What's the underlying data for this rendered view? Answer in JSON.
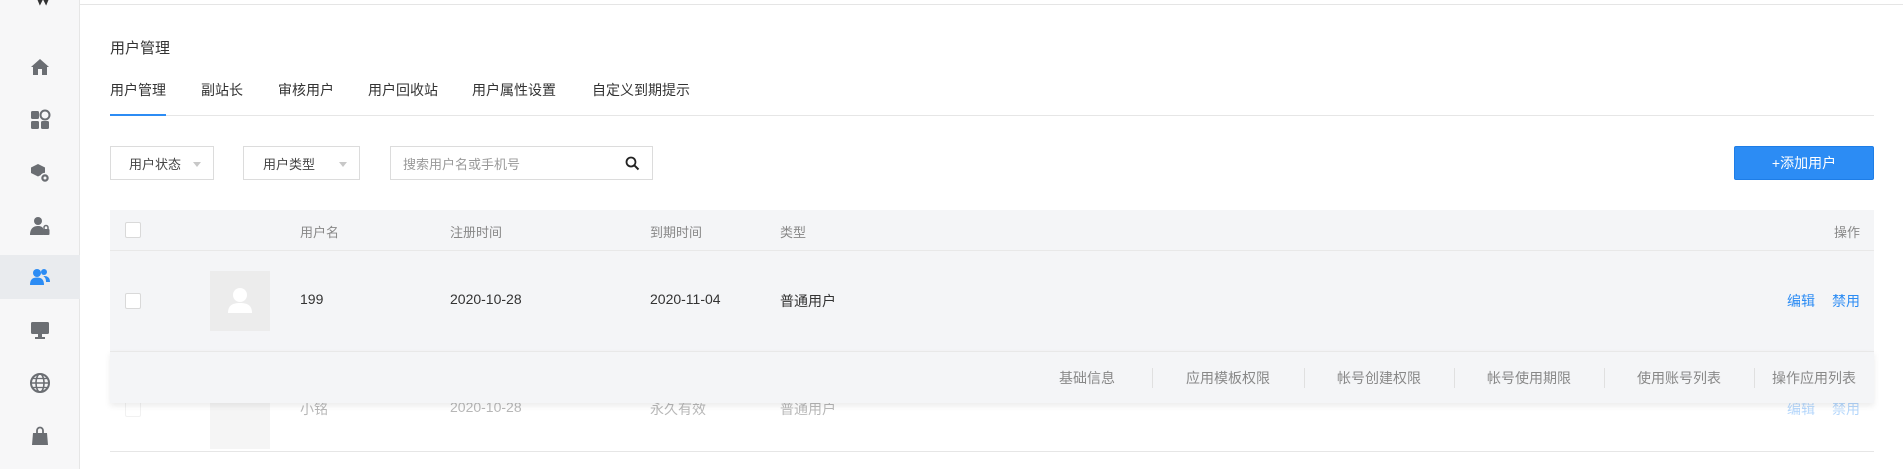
{
  "sidebar": {
    "items": [
      {
        "icon": "home-icon",
        "active": false
      },
      {
        "icon": "apps-icon",
        "active": false
      },
      {
        "icon": "cube-settings-icon",
        "active": false
      },
      {
        "icon": "user-lock-icon",
        "active": false
      },
      {
        "icon": "users-icon",
        "active": true
      },
      {
        "icon": "monitor-icon",
        "active": false
      },
      {
        "icon": "globe-icon",
        "active": false
      },
      {
        "icon": "bag-icon",
        "active": false
      }
    ]
  },
  "page": {
    "title": "用户管理"
  },
  "tabs": [
    {
      "label": "用户管理",
      "active": true
    },
    {
      "label": "副站长",
      "active": false
    },
    {
      "label": "审核用户",
      "active": false
    },
    {
      "label": "用户回收站",
      "active": false
    },
    {
      "label": "用户属性设置",
      "active": false
    },
    {
      "label": "自定义到期提示",
      "active": false
    }
  ],
  "filters": {
    "status_label": "用户状态",
    "type_label": "用户类型",
    "search_placeholder": "搜索用户名或手机号"
  },
  "actions": {
    "add_user": "+添加用户"
  },
  "table": {
    "headers": {
      "username": "用户名",
      "register_time": "注册时间",
      "expire_time": "到期时间",
      "type": "类型",
      "operation": "操作"
    },
    "rows": [
      {
        "username": "199",
        "register_time": "2020-10-28",
        "expire_time": "2020-11-04",
        "type": "普通用户",
        "edit": "编辑",
        "disable": "禁用"
      },
      {
        "username": "小铭",
        "register_time": "2020-10-28",
        "expire_time": "永久有效",
        "type": "普通用户",
        "edit": "编辑",
        "disable": "禁用"
      }
    ],
    "submenu": [
      "基础信息",
      "应用模板权限",
      "帐号创建权限",
      "帐号使用期限",
      "使用账号列表",
      "操作应用列表"
    ]
  },
  "colors": {
    "accent": "#2c8cf4",
    "sidebar_bg": "#f7f7f8",
    "row_bg": "#f4f5f7"
  }
}
